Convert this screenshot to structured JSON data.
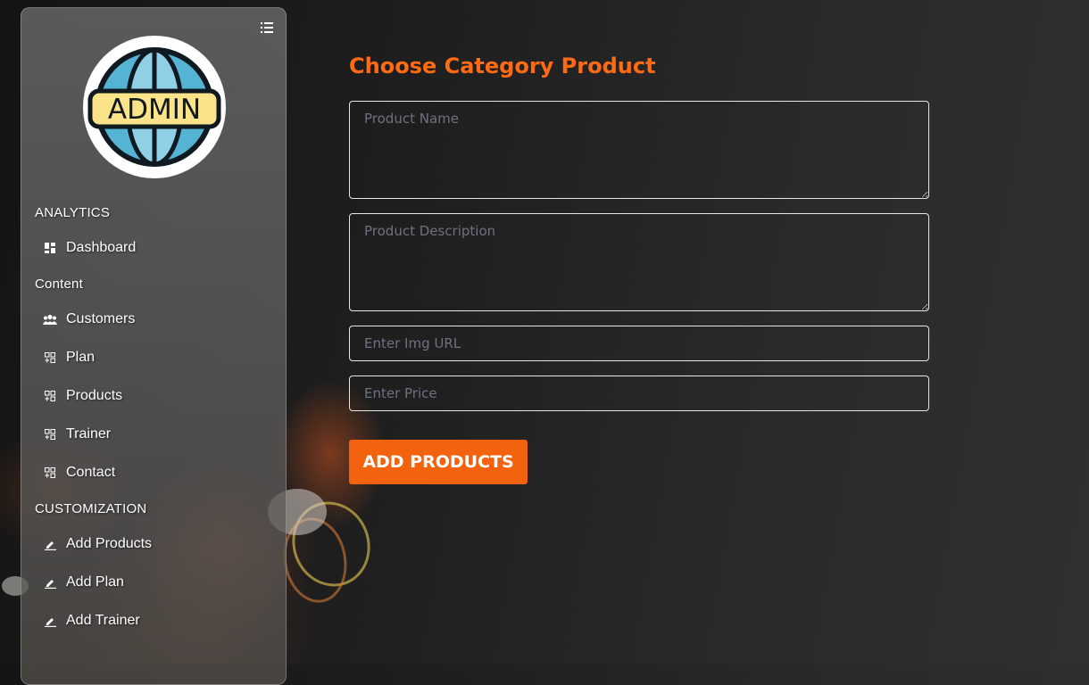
{
  "sidebar": {
    "logo_text": "ADMIN",
    "sections": [
      {
        "title": "ANALYTICS"
      },
      {
        "title": "Content"
      },
      {
        "title": "CUSTOMIZATION"
      }
    ],
    "items": [
      {
        "label": "Dashboard",
        "icon": "dashboard-icon"
      },
      {
        "label": "Customers",
        "icon": "users-icon"
      },
      {
        "label": "Plan",
        "icon": "grid-plus-icon"
      },
      {
        "label": "Products",
        "icon": "grid-plus-icon"
      },
      {
        "label": "Trainer",
        "icon": "grid-plus-icon"
      },
      {
        "label": "Contact",
        "icon": "grid-plus-icon"
      },
      {
        "label": "Add Products",
        "icon": "edit-icon"
      },
      {
        "label": "Add Plan",
        "icon": "edit-icon"
      },
      {
        "label": "Add Trainer",
        "icon": "edit-icon"
      }
    ]
  },
  "form": {
    "title": "Choose Category Product",
    "name_placeholder": "Product Name",
    "description_placeholder": "Product Description",
    "img_placeholder": "Enter Img URL",
    "price_placeholder": "Enter Price",
    "submit_label": "ADD PRODUCTS"
  },
  "colors": {
    "accent": "#f2620f",
    "title": "#ff6a13",
    "background": "#1e1e1e"
  }
}
